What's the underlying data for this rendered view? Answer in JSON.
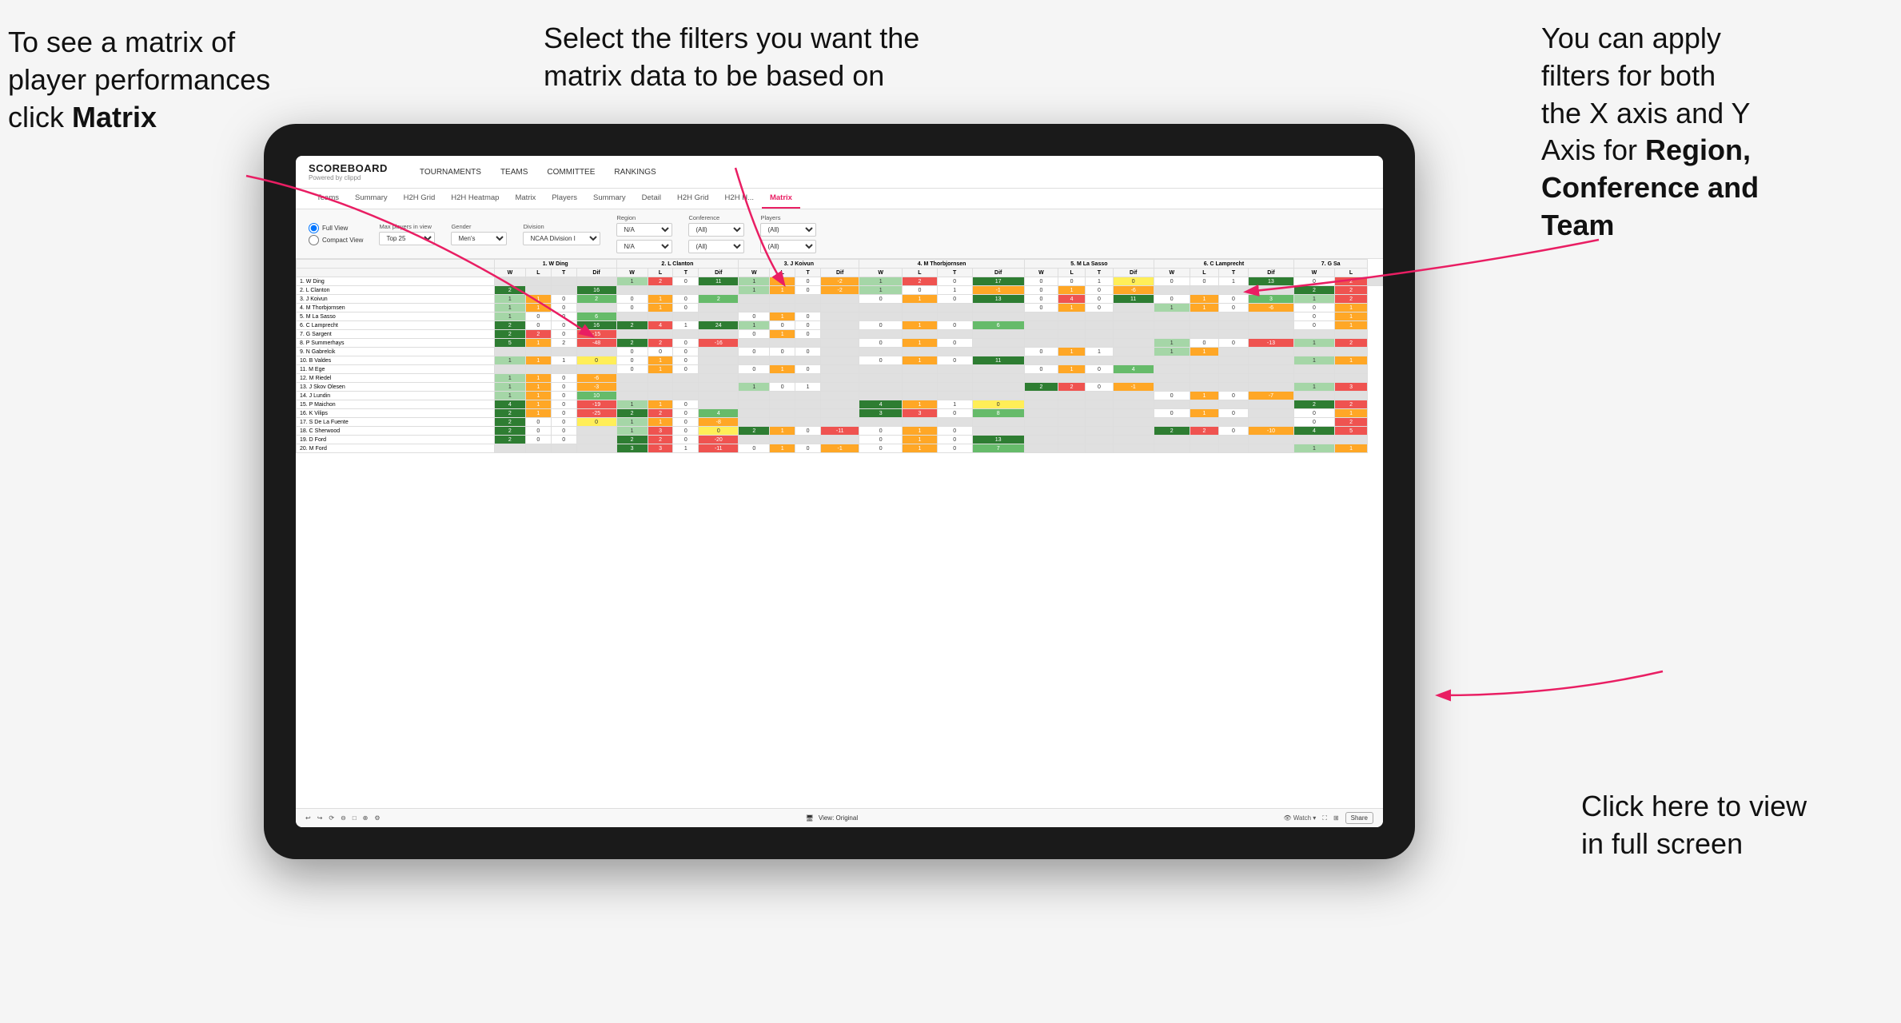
{
  "annotations": {
    "top_left": {
      "line1": "To see a matrix of",
      "line2": "player performances",
      "line3_prefix": "click ",
      "line3_bold": "Matrix"
    },
    "top_middle": {
      "text": "Select the filters you want the matrix data to be based on"
    },
    "top_right": {
      "line1": "You  can apply",
      "line2": "filters for both",
      "line3": "the X axis and Y",
      "line4_prefix": "Axis for ",
      "line4_bold": "Region,",
      "line5_bold": "Conference and",
      "line6_bold": "Team"
    },
    "bottom_right": {
      "line1": "Click here to view",
      "line2": "in full screen"
    }
  },
  "nav": {
    "logo": "SCOREBOARD",
    "logo_sub": "Powered by clippd",
    "items": [
      "TOURNAMENTS",
      "TEAMS",
      "COMMITTEE",
      "RANKINGS"
    ]
  },
  "sub_nav": {
    "items": [
      "Teams",
      "Summary",
      "H2H Grid",
      "H2H Heatmap",
      "Matrix",
      "Players",
      "Summary",
      "Detail",
      "H2H Grid",
      "H2H H...",
      "Matrix"
    ],
    "active_index": 10
  },
  "filters": {
    "view_options": [
      "Full View",
      "Compact View"
    ],
    "active_view": "Full View",
    "max_players_label": "Max players in view",
    "max_players_value": "Top 25",
    "gender_label": "Gender",
    "gender_value": "Men's",
    "division_label": "Division",
    "division_value": "NCAA Division I",
    "region_label": "Region",
    "region_value": "N/A",
    "region_value2": "N/A",
    "conference_label": "Conference",
    "conference_value": "(All)",
    "conference_value2": "(All)",
    "players_label": "Players",
    "players_value": "(All)",
    "players_value2": "(All)"
  },
  "matrix": {
    "col_headers": [
      "1. W Ding",
      "2. L Clanton",
      "3. J Koivun",
      "4. M Thorbjornsen",
      "5. M La Sasso",
      "6. C Lamprecht",
      "7. G Sa"
    ],
    "sub_headers": [
      "W",
      "L",
      "T",
      "Dif"
    ],
    "rows": [
      {
        "name": "1. W Ding",
        "cells": [
          [
            "",
            "",
            "",
            ""
          ],
          [
            "1",
            "2",
            "0",
            "11"
          ],
          [
            "1",
            "1",
            "0",
            "-2"
          ],
          [
            "1",
            "2",
            "0",
            "17"
          ],
          [
            "0",
            "0",
            "1",
            "0"
          ],
          [
            "0",
            "0",
            "1",
            "13"
          ],
          [
            "0",
            "2",
            ""
          ]
        ]
      },
      {
        "name": "2. L Clanton",
        "cells": [
          [
            "2",
            "",
            "",
            "16"
          ],
          [
            "",
            "",
            "",
            ""
          ],
          [
            "1",
            "1",
            "0",
            "-2"
          ],
          [
            "1",
            "0",
            "1",
            "-1"
          ],
          [
            "0",
            "1",
            "0",
            "-6"
          ],
          [
            "",
            "",
            "",
            ""
          ],
          [
            "2",
            "2"
          ]
        ]
      },
      {
        "name": "3. J Koivun",
        "cells": [
          [
            "1",
            "1",
            "0",
            "2"
          ],
          [
            "0",
            "1",
            "0",
            "2"
          ],
          [
            "",
            "",
            "",
            ""
          ],
          [
            "0",
            "1",
            "0",
            "13"
          ],
          [
            "0",
            "4",
            "0",
            "11"
          ],
          [
            "0",
            "1",
            "0",
            "3"
          ],
          [
            "1",
            "2"
          ]
        ]
      },
      {
        "name": "4. M Thorbjornsen",
        "cells": [
          [
            "1",
            "1",
            "0",
            ""
          ],
          [
            "0",
            "1",
            "0",
            ""
          ],
          [
            "",
            "",
            "",
            ""
          ],
          [
            "",
            "",
            "",
            ""
          ],
          [
            "0",
            "1",
            "0",
            ""
          ],
          [
            "1",
            "1",
            "0",
            "-6"
          ],
          [
            "0",
            "1"
          ]
        ]
      },
      {
        "name": "5. M La Sasso",
        "cells": [
          [
            "1",
            "0",
            "0",
            "6"
          ],
          [
            "",
            "",
            "",
            ""
          ],
          [
            "0",
            "1",
            "0",
            ""
          ],
          [
            "",
            "",
            "",
            ""
          ],
          [
            "",
            "",
            "",
            ""
          ],
          [
            "",
            "",
            "",
            ""
          ],
          [
            "0",
            "1"
          ]
        ]
      },
      {
        "name": "6. C Lamprecht",
        "cells": [
          [
            "2",
            "0",
            "0",
            "16"
          ],
          [
            "2",
            "4",
            "1",
            "24"
          ],
          [
            "1",
            "0",
            "0",
            ""
          ],
          [
            "0",
            "1",
            "0",
            "6"
          ],
          [
            "",
            "",
            "",
            ""
          ],
          [
            "",
            "",
            "",
            ""
          ],
          [
            "0",
            "1"
          ]
        ]
      },
      {
        "name": "7. G Sargent",
        "cells": [
          [
            "2",
            "2",
            "0",
            "-15"
          ],
          [
            "",
            "",
            "",
            ""
          ],
          [
            "0",
            "1",
            "0",
            ""
          ],
          [
            "",
            "",
            "",
            ""
          ],
          [
            "",
            "",
            "",
            ""
          ],
          [
            "",
            "",
            "",
            ""
          ],
          [
            "",
            ""
          ]
        ]
      },
      {
        "name": "8. P Summerhays",
        "cells": [
          [
            "5",
            "1",
            "2",
            "-48"
          ],
          [
            "2",
            "2",
            "0",
            "-16"
          ],
          [
            "",
            "",
            "",
            ""
          ],
          [
            "0",
            "1",
            "0",
            ""
          ],
          [
            "",
            "",
            "",
            ""
          ],
          [
            "1",
            "0",
            "0",
            "-13"
          ],
          [
            "1",
            "2"
          ]
        ]
      },
      {
        "name": "9. N Gabrelcik",
        "cells": [
          [
            "",
            "",
            "",
            ""
          ],
          [
            "0",
            "0",
            "0",
            ""
          ],
          [
            "0",
            "0",
            "0",
            ""
          ],
          [
            "",
            "",
            "",
            ""
          ],
          [
            "0",
            "1",
            "1",
            ""
          ],
          [
            "1",
            "1",
            "",
            ""
          ],
          [
            "",
            ""
          ]
        ]
      },
      {
        "name": "10. B Valdes",
        "cells": [
          [
            "1",
            "1",
            "1",
            "0"
          ],
          [
            "0",
            "1",
            "0",
            ""
          ],
          [
            "",
            "",
            "",
            ""
          ],
          [
            "0",
            "1",
            "0",
            "11"
          ],
          [
            "",
            "",
            "",
            ""
          ],
          [
            "",
            "",
            "",
            ""
          ],
          [
            "1",
            "1"
          ]
        ]
      },
      {
        "name": "11. M Ege",
        "cells": [
          [
            "",
            "",
            "",
            ""
          ],
          [
            "0",
            "1",
            "0",
            ""
          ],
          [
            "0",
            "1",
            "0",
            ""
          ],
          [
            "",
            "",
            "",
            ""
          ],
          [
            "0",
            "1",
            "0",
            "4"
          ],
          [
            "",
            "",
            "",
            ""
          ],
          [
            "",
            ""
          ]
        ]
      },
      {
        "name": "12. M Riedel",
        "cells": [
          [
            "1",
            "1",
            "0",
            "-6"
          ],
          [
            "",
            "",
            "",
            ""
          ],
          [
            "",
            "",
            "",
            ""
          ],
          [
            "",
            "",
            "",
            ""
          ],
          [
            "",
            "",
            "",
            ""
          ],
          [
            "",
            "",
            "",
            ""
          ],
          [
            "",
            ""
          ]
        ]
      },
      {
        "name": "13. J Skov Olesen",
        "cells": [
          [
            "1",
            "1",
            "0",
            "-3"
          ],
          [
            "",
            "",
            "",
            ""
          ],
          [
            "1",
            "0",
            "1",
            ""
          ],
          [
            "",
            "",
            "",
            ""
          ],
          [
            "2",
            "2",
            "0",
            "-1"
          ],
          [
            "",
            "",
            "",
            ""
          ],
          [
            "1",
            "3"
          ]
        ]
      },
      {
        "name": "14. J Lundin",
        "cells": [
          [
            "1",
            "1",
            "0",
            "10"
          ],
          [
            "",
            "",
            "",
            ""
          ],
          [
            "",
            "",
            "",
            ""
          ],
          [
            "",
            "",
            "",
            ""
          ],
          [
            "",
            "",
            "",
            ""
          ],
          [
            "0",
            "1",
            "0",
            "-7"
          ],
          [
            "",
            ""
          ]
        ]
      },
      {
        "name": "15. P Maichon",
        "cells": [
          [
            "4",
            "1",
            "0",
            "-19"
          ],
          [
            "1",
            "1",
            "0",
            ""
          ],
          [
            "",
            "",
            "",
            ""
          ],
          [
            "4",
            "1",
            "1",
            "0"
          ],
          [
            "",
            "",
            "",
            ""
          ],
          [
            "",
            "",
            "",
            ""
          ],
          [
            "2",
            "2"
          ]
        ]
      },
      {
        "name": "16. K Vilips",
        "cells": [
          [
            "2",
            "1",
            "0",
            "-25"
          ],
          [
            "2",
            "2",
            "0",
            "4"
          ],
          [
            "",
            "",
            "",
            ""
          ],
          [
            "3",
            "3",
            "0",
            "8"
          ],
          [
            "",
            "",
            "",
            ""
          ],
          [
            "0",
            "1",
            "0",
            ""
          ],
          [
            "0",
            "1"
          ]
        ]
      },
      {
        "name": "17. S De La Fuente",
        "cells": [
          [
            "2",
            "0",
            "0",
            "0"
          ],
          [
            "1",
            "1",
            "0",
            "-8"
          ],
          [
            "",
            "",
            "",
            ""
          ],
          [
            "",
            "",
            "",
            ""
          ],
          [
            "",
            "",
            "",
            ""
          ],
          [
            "",
            "",
            "",
            ""
          ],
          [
            "0",
            "2"
          ]
        ]
      },
      {
        "name": "18. C Sherwood",
        "cells": [
          [
            "2",
            "0",
            "0",
            ""
          ],
          [
            "1",
            "3",
            "0",
            "0"
          ],
          [
            "2",
            "1",
            "0",
            "-11"
          ],
          [
            "0",
            "1",
            "0",
            ""
          ],
          [
            "",
            "",
            "",
            ""
          ],
          [
            "2",
            "2",
            "0",
            "-10"
          ],
          [
            "4",
            "5"
          ]
        ]
      },
      {
        "name": "19. D Ford",
        "cells": [
          [
            "2",
            "0",
            "0",
            ""
          ],
          [
            "2",
            "2",
            "0",
            "-20"
          ],
          [
            "",
            "",
            "",
            ""
          ],
          [
            "0",
            "1",
            "0",
            "13"
          ],
          [
            "",
            "",
            "",
            ""
          ],
          [
            "",
            "",
            "",
            ""
          ],
          [
            "",
            ""
          ]
        ]
      },
      {
        "name": "20. M Ford",
        "cells": [
          [
            "",
            "",
            "",
            ""
          ],
          [
            "3",
            "3",
            "1",
            "-11"
          ],
          [
            "0",
            "1",
            "0",
            "-1"
          ],
          [
            "0",
            "1",
            "0",
            "7"
          ],
          [
            "",
            "",
            "",
            ""
          ],
          [
            "",
            "",
            "",
            ""
          ],
          [
            "1",
            "1"
          ]
        ]
      }
    ]
  },
  "bottom_bar": {
    "view_label": "View: Original",
    "watch_label": "Watch",
    "share_label": "Share"
  }
}
